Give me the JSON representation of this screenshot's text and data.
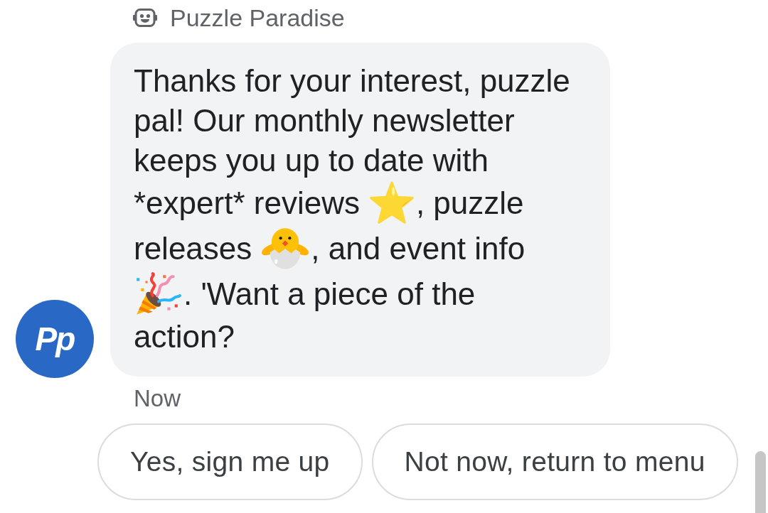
{
  "sender": {
    "name": "Puzzle Paradise"
  },
  "avatar": {
    "initials": "Pp"
  },
  "message": {
    "lines": [
      [
        {
          "kind": "text",
          "text": "Thanks for your interest, puzzle"
        }
      ],
      [
        {
          "kind": "text",
          "text": "pal! Our monthly newsletter"
        }
      ],
      [
        {
          "kind": "text",
          "text": "keeps you up to date with"
        }
      ],
      [
        {
          "kind": "text",
          "text": "*expert* reviews"
        },
        {
          "kind": "star"
        },
        {
          "kind": "text",
          "text": ", puzzle"
        }
      ],
      [
        {
          "kind": "text",
          "text": "releases"
        },
        {
          "kind": "chick"
        },
        {
          "kind": "text",
          "text": ", and event info"
        }
      ],
      [
        {
          "kind": "popper"
        },
        {
          "kind": "text",
          "text": ". 'Want a piece of the"
        }
      ],
      [
        {
          "kind": "text",
          "text": "action?"
        }
      ]
    ],
    "time": "Now"
  },
  "suggestions": [
    {
      "label": "Yes, sign me up"
    },
    {
      "label": "Not now, return to menu"
    }
  ]
}
